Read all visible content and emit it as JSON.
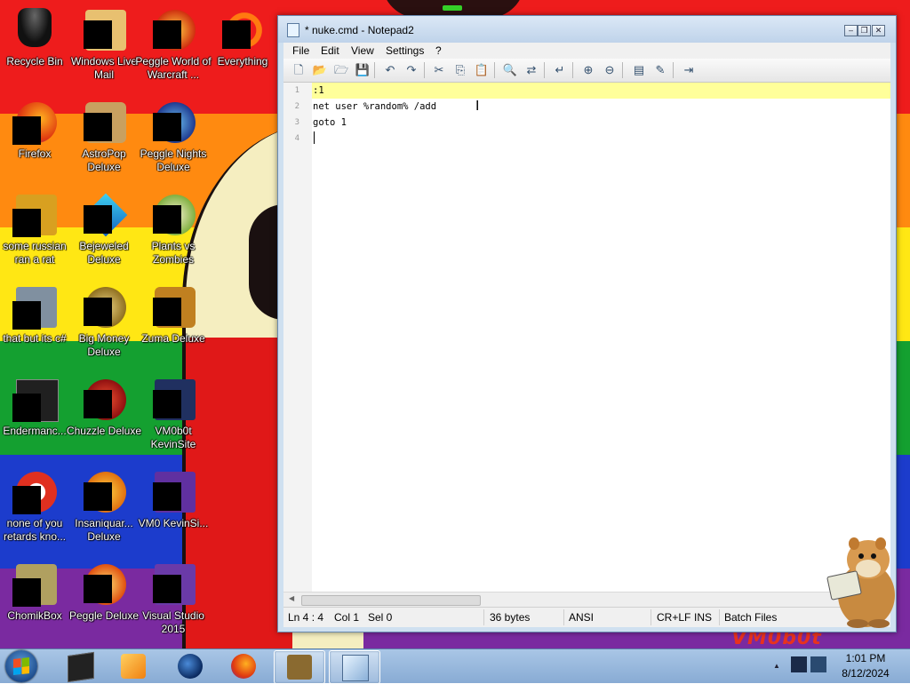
{
  "desktop": {
    "watermark": "VM0b0t",
    "icons": [
      {
        "label": "Recycle Bin"
      },
      {
        "label": "Windows Live Mail"
      },
      {
        "label": "Peggle World of Warcraft ..."
      },
      {
        "label": "Everything"
      },
      {
        "label": "Firefox"
      },
      {
        "label": "AstroPop Deluxe"
      },
      {
        "label": "Peggle Nights Deluxe"
      },
      {
        "label": "some russian ran a rat"
      },
      {
        "label": "Bejeweled Deluxe"
      },
      {
        "label": "Plants vs Zombies"
      },
      {
        "label": "that but its c#"
      },
      {
        "label": "Big Money Deluxe"
      },
      {
        "label": "Zuma Deluxe"
      },
      {
        "label": "Endermanc..."
      },
      {
        "label": "Chuzzle Deluxe"
      },
      {
        "label": "VM0b0t KevinSite"
      },
      {
        "label": "none of you retards kno..."
      },
      {
        "label": "Insaniquar... Deluxe"
      },
      {
        "label": "VM0 KevinSi..."
      },
      {
        "label": "ChomikBox"
      },
      {
        "label": "Peggle Deluxe"
      },
      {
        "label": "Visual Studio 2015"
      }
    ]
  },
  "window": {
    "title": "* nuke.cmd - Notepad2",
    "controls": {
      "minimize": "–",
      "restore": "❐",
      "close": "✕"
    },
    "menu": [
      "File",
      "Edit",
      "View",
      "Settings",
      "?"
    ],
    "toolbar": [
      {
        "icon": "new-icon",
        "glyph": "🗋"
      },
      {
        "icon": "open-icon",
        "glyph": "📂"
      },
      {
        "icon": "browse-icon",
        "glyph": "🗁"
      },
      {
        "icon": "save-icon",
        "glyph": "💾"
      },
      {
        "icon": "undo-icon",
        "glyph": "↶"
      },
      {
        "icon": "redo-icon",
        "glyph": "↷"
      },
      {
        "icon": "cut-icon",
        "glyph": "✂"
      },
      {
        "icon": "copy-icon",
        "glyph": "⎘"
      },
      {
        "icon": "paste-icon",
        "glyph": "📋"
      },
      {
        "icon": "find-icon",
        "glyph": "🔍"
      },
      {
        "icon": "replace-icon",
        "glyph": "⇄"
      },
      {
        "icon": "wordwrap-icon",
        "glyph": "↵"
      },
      {
        "icon": "zoom-in-icon",
        "glyph": "⊕"
      },
      {
        "icon": "zoom-out-icon",
        "glyph": "⊖"
      },
      {
        "icon": "scheme-icon",
        "glyph": "▤"
      },
      {
        "icon": "customize-scheme-icon",
        "glyph": "✎"
      },
      {
        "icon": "exit-icon",
        "glyph": "⇥"
      }
    ],
    "editor": {
      "line_numbers": [
        "1",
        "2",
        "3",
        "4"
      ],
      "lines": [
        ":1",
        "net user %random% /add",
        "goto 1",
        ""
      ]
    },
    "status": {
      "position": "Ln 4 : 4",
      "column": "Col 1",
      "selection": "Sel 0",
      "size": "36 bytes",
      "encoding": "ANSI",
      "line_endings": "CR+LF",
      "mode": "INS",
      "scheme": "Batch Files"
    }
  },
  "taskbar": {
    "items": [
      {
        "name": "taskbar-terminal"
      },
      {
        "name": "taskbar-media-player"
      },
      {
        "name": "taskbar-globe"
      },
      {
        "name": "taskbar-firefox"
      },
      {
        "name": "taskbar-chomikbox"
      },
      {
        "name": "taskbar-notepad2"
      }
    ],
    "show_hidden": "▲",
    "time": "1:01 PM",
    "date": "8/12/2024"
  }
}
